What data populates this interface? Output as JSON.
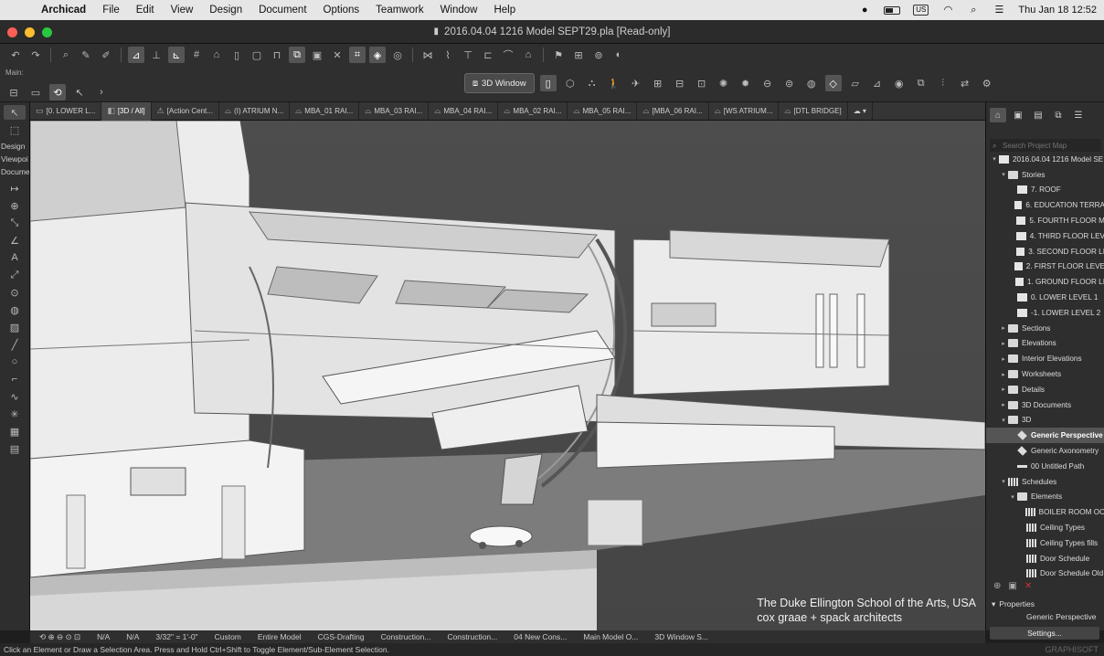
{
  "menubar": {
    "app_name": "Archicad",
    "items": [
      "File",
      "Edit",
      "View",
      "Design",
      "Document",
      "Options",
      "Teamwork",
      "Window",
      "Help"
    ],
    "keyboard_label": "US",
    "clock": "Thu Jan 18  12:52"
  },
  "window": {
    "title": "2016.04.04 1216 Model SEPT29.pla [Read-only]"
  },
  "toolbar": {
    "main_label": "Main:",
    "window_button": "3D Window"
  },
  "toolbox": {
    "labels": [
      "Design",
      "Viewpoi",
      "Docume"
    ]
  },
  "tabs": [
    {
      "label": "[0. LOWER L...",
      "icon": "plan-icon"
    },
    {
      "label": "[3D / All]",
      "icon": "3d-icon"
    },
    {
      "label": "[Action Cent...",
      "icon": "action-icon"
    },
    {
      "label": "(I) ATRIUM N...",
      "icon": "section-icon"
    },
    {
      "label": "MBA_01 RAI...",
      "icon": "section-icon"
    },
    {
      "label": "MBA_03 RAI...",
      "icon": "section-icon"
    },
    {
      "label": "MBA_04 RAI...",
      "icon": "section-icon"
    },
    {
      "label": "MBA_02 RAI...",
      "icon": "section-icon"
    },
    {
      "label": "MBA_05 RAI...",
      "icon": "section-icon"
    },
    {
      "label": "[MBA_06 RAI...",
      "icon": "section-icon"
    },
    {
      "label": "[WS ATRIUM...",
      "icon": "section-icon"
    },
    {
      "label": "[DTL BRIDGE]",
      "icon": "detail-icon"
    }
  ],
  "viewport": {
    "caption_line1": "The Duke Ellington School of the Arts, USA",
    "caption_line2": "cox graae + spack architects"
  },
  "navigator": {
    "search_placeholder": "Search Project Map",
    "tree": [
      {
        "label": "2016.04.04 1216 Model SE",
        "indent": 0,
        "arrow": "▾",
        "icon": "i-doc"
      },
      {
        "label": "Stories",
        "indent": 1,
        "arrow": "▾",
        "icon": "i-folder"
      },
      {
        "label": "7. ROOF",
        "indent": 2,
        "arrow": "",
        "icon": "i-doc"
      },
      {
        "label": "6. EDUCATION TERRA",
        "indent": 2,
        "arrow": "",
        "icon": "i-doc"
      },
      {
        "label": "5. FOURTH FLOOR M",
        "indent": 2,
        "arrow": "",
        "icon": "i-doc"
      },
      {
        "label": "4. THIRD FLOOR LEV",
        "indent": 2,
        "arrow": "",
        "icon": "i-doc"
      },
      {
        "label": "3. SECOND FLOOR LI",
        "indent": 2,
        "arrow": "",
        "icon": "i-doc"
      },
      {
        "label": "2. FIRST FLOOR LEVE",
        "indent": 2,
        "arrow": "",
        "icon": "i-doc"
      },
      {
        "label": "1. GROUND FLOOR LI",
        "indent": 2,
        "arrow": "",
        "icon": "i-doc"
      },
      {
        "label": "0. LOWER LEVEL 1",
        "indent": 2,
        "arrow": "",
        "icon": "i-doc"
      },
      {
        "label": "-1. LOWER LEVEL 2",
        "indent": 2,
        "arrow": "",
        "icon": "i-doc"
      },
      {
        "label": "Sections",
        "indent": 1,
        "arrow": "▸",
        "icon": "i-folder"
      },
      {
        "label": "Elevations",
        "indent": 1,
        "arrow": "▸",
        "icon": "i-folder"
      },
      {
        "label": "Interior Elevations",
        "indent": 1,
        "arrow": "▸",
        "icon": "i-folder"
      },
      {
        "label": "Worksheets",
        "indent": 1,
        "arrow": "▸",
        "icon": "i-folder"
      },
      {
        "label": "Details",
        "indent": 1,
        "arrow": "▸",
        "icon": "i-folder"
      },
      {
        "label": "3D Documents",
        "indent": 1,
        "arrow": "▸",
        "icon": "i-folder"
      },
      {
        "label": "3D",
        "indent": 1,
        "arrow": "▾",
        "icon": "i-folder"
      },
      {
        "label": "Generic Perspective",
        "indent": 2,
        "arrow": "",
        "icon": "i-cube",
        "selected": true
      },
      {
        "label": "Generic Axonometry",
        "indent": 2,
        "arrow": "",
        "icon": "i-cube"
      },
      {
        "label": "00 Untitled Path",
        "indent": 2,
        "arrow": "",
        "icon": "i-path"
      },
      {
        "label": "Schedules",
        "indent": 1,
        "arrow": "▾",
        "icon": "i-grid"
      },
      {
        "label": "Elements",
        "indent": 2,
        "arrow": "▾",
        "icon": "i-folder"
      },
      {
        "label": "BOILER ROOM OC",
        "indent": 3,
        "arrow": "",
        "icon": "i-grid"
      },
      {
        "label": "Ceiling Types",
        "indent": 3,
        "arrow": "",
        "icon": "i-grid"
      },
      {
        "label": "Ceiling Types fills",
        "indent": 3,
        "arrow": "",
        "icon": "i-grid"
      },
      {
        "label": "Door Schedule",
        "indent": 3,
        "arrow": "",
        "icon": "i-grid"
      },
      {
        "label": "Door Schedule Old",
        "indent": 3,
        "arrow": "",
        "icon": "i-grid"
      }
    ],
    "properties_label": "Properties",
    "properties_value": "Generic Perspective",
    "settings_button": "Settings..."
  },
  "statusbar": {
    "items": [
      "N/A",
      "N/A",
      "3/32\" = 1'-0\"",
      "Custom",
      "Entire Model",
      "CGS-Drafting",
      "Construction...",
      "Construction...",
      "04 New Cons...",
      "Main Model O...",
      "3D Window S..."
    ]
  },
  "hint": "Click an Element or Draw a Selection Area. Press and Hold Ctrl+Shift to Toggle Element/Sub-Element Selection.",
  "brand": "GRAPHISOFT"
}
